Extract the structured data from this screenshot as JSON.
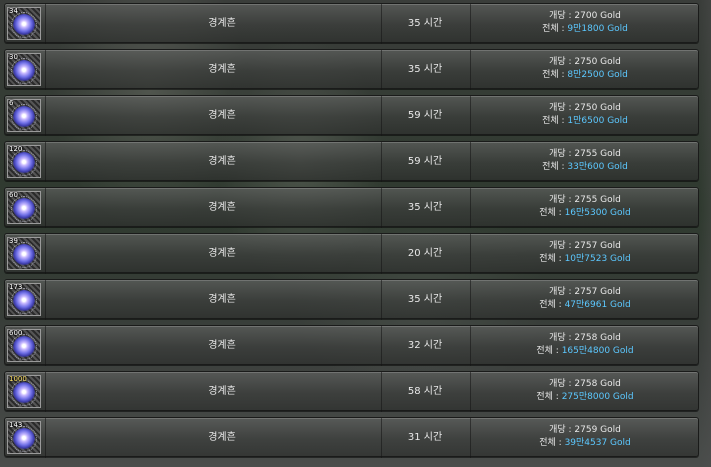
{
  "rows": [
    {
      "qty": "34",
      "name": "경계흔",
      "hours": "35 시간",
      "unit_label": "개당 : ",
      "unit": "2700 Gold",
      "total_label": "전체 : ",
      "total": "9만1800 Gold",
      "qty_gold": false
    },
    {
      "qty": "30",
      "name": "경계흔",
      "hours": "35 시간",
      "unit_label": "개당 : ",
      "unit": "2750 Gold",
      "total_label": "전체 : ",
      "total": "8만2500 Gold",
      "qty_gold": false
    },
    {
      "qty": "6",
      "name": "경계흔",
      "hours": "59 시간",
      "unit_label": "개당 : ",
      "unit": "2750 Gold",
      "total_label": "전체 : ",
      "total": "1만6500 Gold",
      "qty_gold": false
    },
    {
      "qty": "120",
      "name": "경계흔",
      "hours": "59 시간",
      "unit_label": "개당 : ",
      "unit": "2755 Gold",
      "total_label": "전체 : ",
      "total": "33만600 Gold",
      "qty_gold": false
    },
    {
      "qty": "60",
      "name": "경계흔",
      "hours": "35 시간",
      "unit_label": "개당 : ",
      "unit": "2755 Gold",
      "total_label": "전체 : ",
      "total": "16만5300 Gold",
      "qty_gold": false
    },
    {
      "qty": "39",
      "name": "경계흔",
      "hours": "20 시간",
      "unit_label": "개당 : ",
      "unit": "2757 Gold",
      "total_label": "전체 : ",
      "total": "10만7523 Gold",
      "qty_gold": false
    },
    {
      "qty": "173",
      "name": "경계흔",
      "hours": "35 시간",
      "unit_label": "개당 : ",
      "unit": "2757 Gold",
      "total_label": "전체 : ",
      "total": "47만6961 Gold",
      "qty_gold": false
    },
    {
      "qty": "600",
      "name": "경계흔",
      "hours": "32 시간",
      "unit_label": "개당 : ",
      "unit": "2758 Gold",
      "total_label": "전체 : ",
      "total": "165만4800 Gold",
      "qty_gold": false
    },
    {
      "qty": "1000",
      "name": "경계흔",
      "hours": "58 시간",
      "unit_label": "개당 : ",
      "unit": "2758 Gold",
      "total_label": "전체 : ",
      "total": "275만8000 Gold",
      "qty_gold": true
    },
    {
      "qty": "143",
      "name": "경계흔",
      "hours": "31 시간",
      "unit_label": "개당 : ",
      "unit": "2759 Gold",
      "total_label": "전체 : ",
      "total": "39만4537 Gold",
      "qty_gold": false
    }
  ],
  "colors": {
    "total_text": "#5cc8ff",
    "qty_highlight": "#ffe36a",
    "row_border": "#1a1b1a"
  },
  "icons": {
    "item": "soul-gem-icon"
  }
}
